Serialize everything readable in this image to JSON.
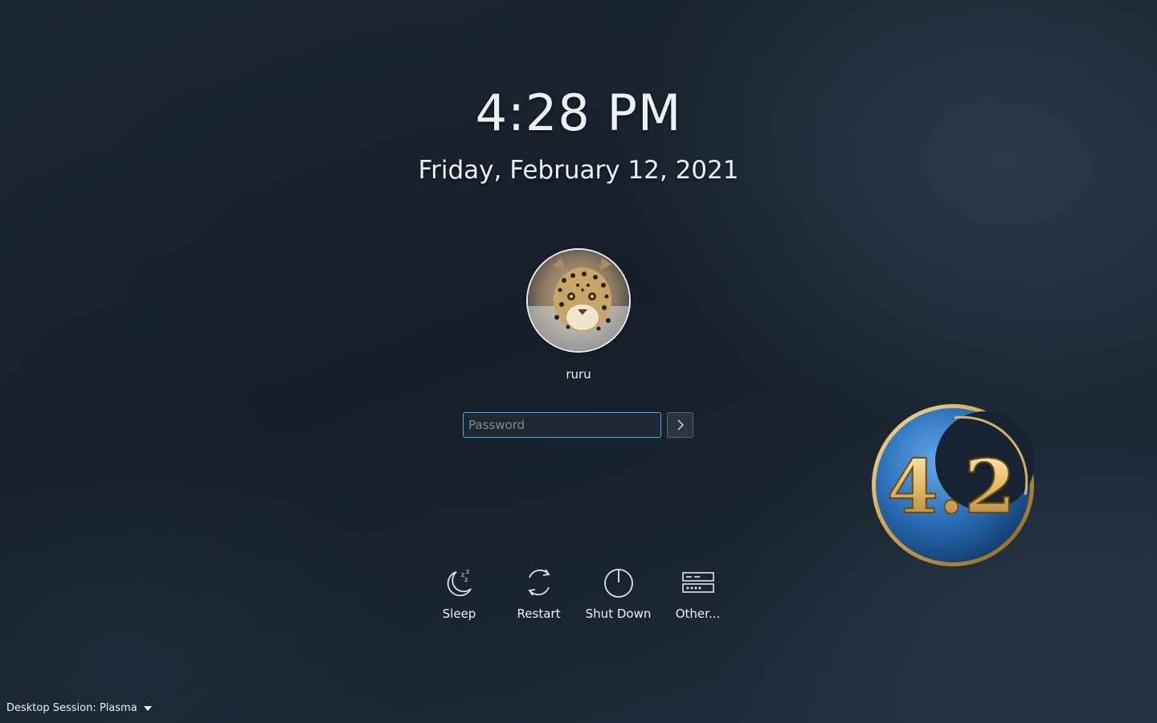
{
  "lock_screen": {
    "time": "4:28 PM",
    "date": "Friday, February 12, 2021"
  },
  "user": {
    "name": "ruru",
    "avatar_icon": "leopard-avatar"
  },
  "password": {
    "placeholder": "Password",
    "value": "",
    "login_icon": "chevron-right-icon"
  },
  "actions": [
    {
      "label": "Sleep",
      "icon": "sleep-moon-icon"
    },
    {
      "label": "Restart",
      "icon": "restart-icon"
    },
    {
      "label": "Shut Down",
      "icon": "power-icon"
    },
    {
      "label": "Other...",
      "icon": "switch-user-icon"
    }
  ],
  "logo": {
    "text": "4.2"
  },
  "session": {
    "label": "Desktop Session: Plasma"
  },
  "colors": {
    "accent": "#3daee9",
    "text": "#eef1f4",
    "logo_blue": "#2a6fb8",
    "logo_gold": "#e0b75c"
  }
}
